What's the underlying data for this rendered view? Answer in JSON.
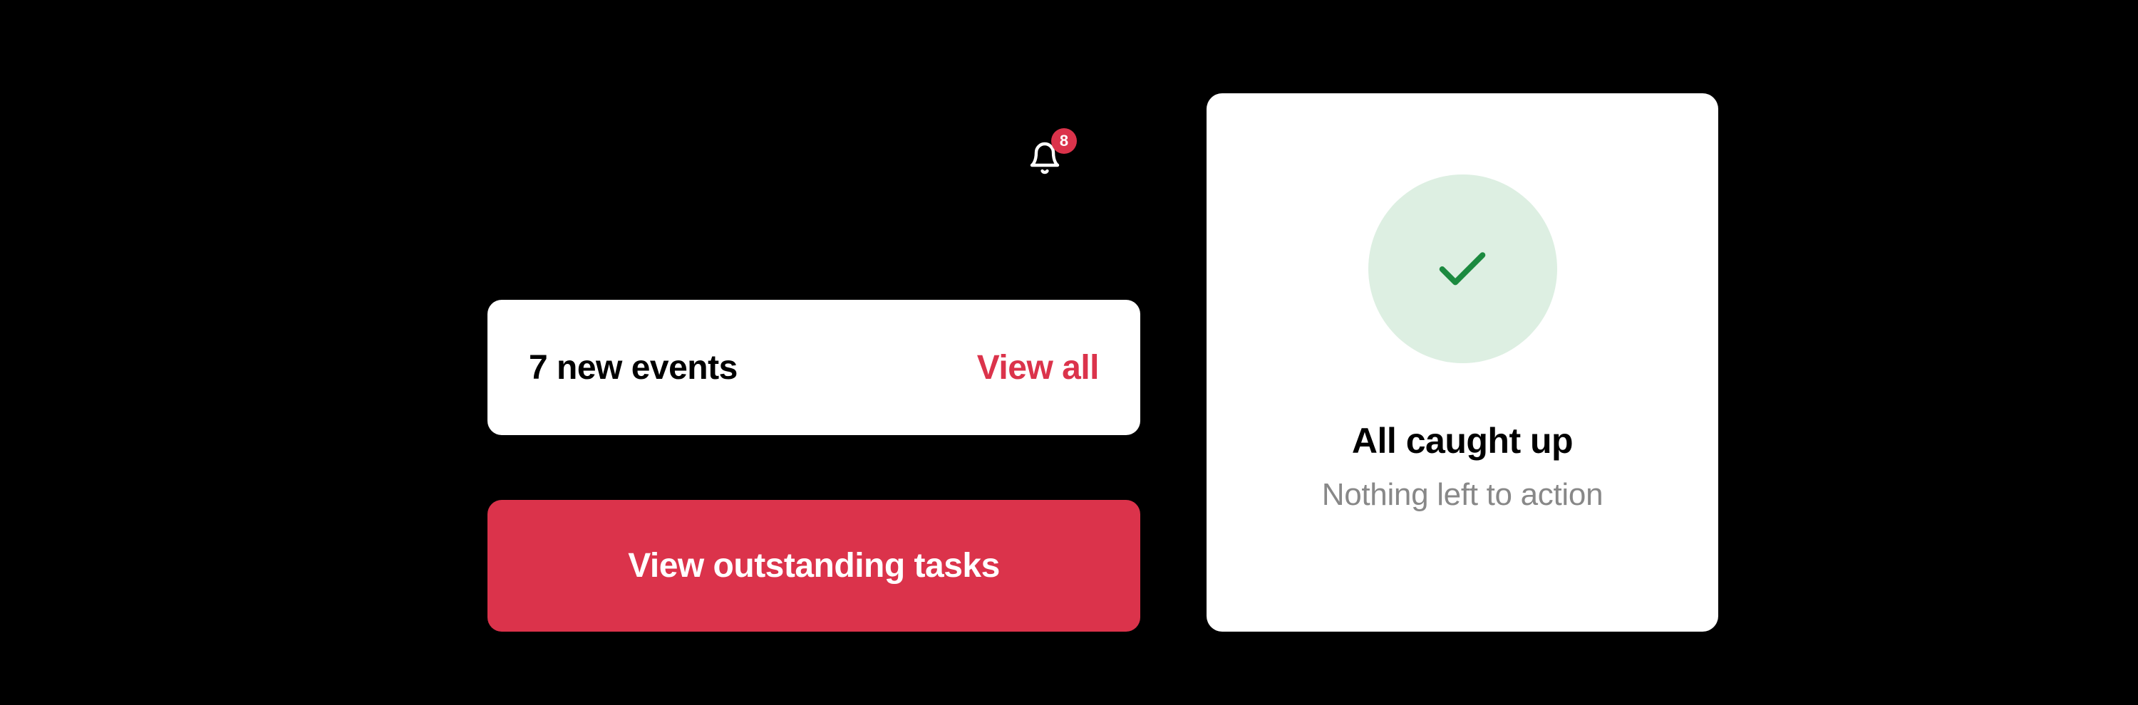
{
  "notifications": {
    "badge_count": "8"
  },
  "events": {
    "title": "7 new events",
    "view_all_label": "View all"
  },
  "tasks": {
    "button_label": "View outstanding tasks"
  },
  "caught_up": {
    "title": "All caught up",
    "subtitle": "Nothing left to action"
  }
}
